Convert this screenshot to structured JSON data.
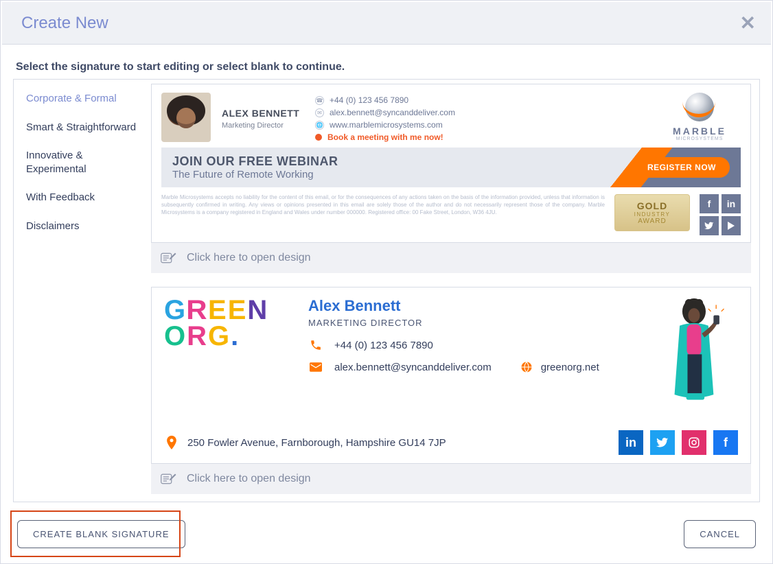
{
  "modal": {
    "title": "Create New",
    "instruction": "Select the signature to start editing or select blank to continue."
  },
  "sidebar": {
    "items": [
      {
        "label": "Corporate & Formal",
        "active": true
      },
      {
        "label": "Smart & Straightforward",
        "active": false
      },
      {
        "label": "Innovative & Experimental",
        "active": false
      },
      {
        "label": "With Feedback",
        "active": false
      },
      {
        "label": "Disclaimers",
        "active": false
      }
    ]
  },
  "open_design_label": "Click here to open design",
  "template1": {
    "name": "ALEX BENNETT",
    "role": "Marketing Director",
    "phone": "+44 (0) 123 456 7890",
    "email": "alex.bennett@syncanddeliver.com",
    "website": "www.marblemicrosystems.com",
    "meeting": "Book a meeting with me now!",
    "logo_brand": "MARBLE",
    "logo_brand_sub": "MICROSYSTEMS",
    "banner_title": "JOIN OUR FREE WEBINAR",
    "banner_subtitle": "The Future of Remote Working",
    "banner_cta": "REGISTER NOW",
    "legal": "Marble Microsystems accepts no liability for the content of this email, or for the consequences of any actions taken on the basis of the information provided, unless that information is subsequently confirmed in writing. Any views or opinions presented in this email are solely those of the author and do not necessarily represent those of the company. Marble Microsystems is a company registered in England and Wales under number 000000. Registered office: 00 Fake Street, London, W36 4JU.",
    "award_line1": "GOLD",
    "award_line2": "INDUSTRY",
    "award_line3": "AWARD"
  },
  "template2": {
    "logo_line1": "GREEN",
    "logo_line2": "ORG.",
    "name": "Alex Bennett",
    "role": "MARKETING DIRECTOR",
    "phone": "+44 (0) 123 456 7890",
    "email": "alex.bennett@syncanddeliver.com",
    "website": "greenorg.net",
    "address": "250 Fowler Avenue, Farnborough, Hampshire GU14 7JP"
  },
  "footer": {
    "create_blank": "CREATE BLANK SIGNATURE",
    "cancel": "CANCEL"
  }
}
